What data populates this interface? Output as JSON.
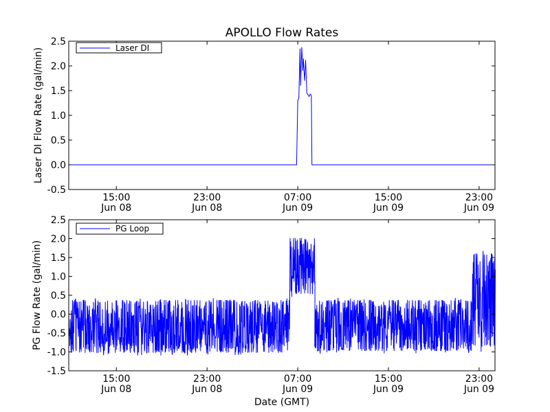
{
  "chart_data": [
    {
      "type": "line",
      "title": "APOLLO Flow Rates",
      "ylabel": "Laser DI Flow Rate (gal/min)",
      "xlabel": "",
      "x_unit": "hours since Jun 08 00:00 GMT",
      "xlim": [
        10.8,
        48.4
      ],
      "ylim": [
        -0.5,
        2.5
      ],
      "yticks": [
        "-0.5",
        "0.0",
        "0.5",
        "1.0",
        "1.5",
        "2.0",
        "2.5"
      ],
      "xticks": [
        {
          "time": "15:00",
          "date": "Jun 08"
        },
        {
          "time": "23:00",
          "date": "Jun 08"
        },
        {
          "time": "07:00",
          "date": "Jun 09"
        },
        {
          "time": "15:00",
          "date": "Jun 09"
        },
        {
          "time": "23:00",
          "date": "Jun 09"
        }
      ],
      "legend": {
        "location": "upper-left",
        "entries": [
          "Laser DI"
        ]
      },
      "series": [
        {
          "name": "Laser DI",
          "color": "#0000ff",
          "points": [
            [
              10.8,
              0.0
            ],
            [
              30.9,
              0.0
            ],
            [
              31.0,
              1.3
            ],
            [
              31.1,
              1.35
            ],
            [
              31.2,
              2.35
            ],
            [
              31.25,
              1.6
            ],
            [
              31.35,
              2.38
            ],
            [
              31.45,
              1.9
            ],
            [
              31.5,
              2.15
            ],
            [
              31.6,
              1.7
            ],
            [
              31.7,
              2.12
            ],
            [
              31.8,
              1.45
            ],
            [
              31.9,
              1.42
            ],
            [
              32.0,
              1.38
            ],
            [
              32.1,
              1.43
            ],
            [
              32.2,
              1.4
            ],
            [
              32.25,
              0.0
            ],
            [
              48.4,
              0.0
            ]
          ]
        }
      ]
    },
    {
      "type": "line",
      "title": "",
      "ylabel": "PG Flow Rate (gal/min)",
      "xlabel": "Date (GMT)",
      "x_unit": "hours since Jun 08 00:00 GMT",
      "xlim": [
        10.8,
        48.4
      ],
      "ylim": [
        -1.5,
        2.5
      ],
      "yticks": [
        "-1.5",
        "-1.0",
        "-0.5",
        "0.0",
        "0.5",
        "1.0",
        "1.5",
        "2.0",
        "2.5"
      ],
      "xticks": [
        {
          "time": "15:00",
          "date": "Jun 08"
        },
        {
          "time": "23:00",
          "date": "Jun 08"
        },
        {
          "time": "07:00",
          "date": "Jun 09"
        },
        {
          "time": "15:00",
          "date": "Jun 09"
        },
        {
          "time": "23:00",
          "date": "Jun 09"
        }
      ],
      "legend": {
        "location": "upper-left",
        "entries": [
          "PG Loop"
        ]
      },
      "series": [
        {
          "name": "PG Loop",
          "color": "#0000ff",
          "segments": [
            {
              "x_start": 10.8,
              "x_end": 30.3,
              "low": -1.1,
              "high": 0.45,
              "sampled_every_hours": 0.05
            },
            {
              "x_start": 30.3,
              "x_end": 32.5,
              "low": 0.45,
              "high": 2.1,
              "sampled_every_hours": 0.05
            },
            {
              "x_start": 32.5,
              "x_end": 46.4,
              "low": -1.05,
              "high": 0.45,
              "sampled_every_hours": 0.05
            },
            {
              "x_start": 46.4,
              "x_end": 48.4,
              "low": -1.0,
              "high": 1.75,
              "sampled_every_hours": 0.05
            }
          ]
        }
      ]
    }
  ]
}
